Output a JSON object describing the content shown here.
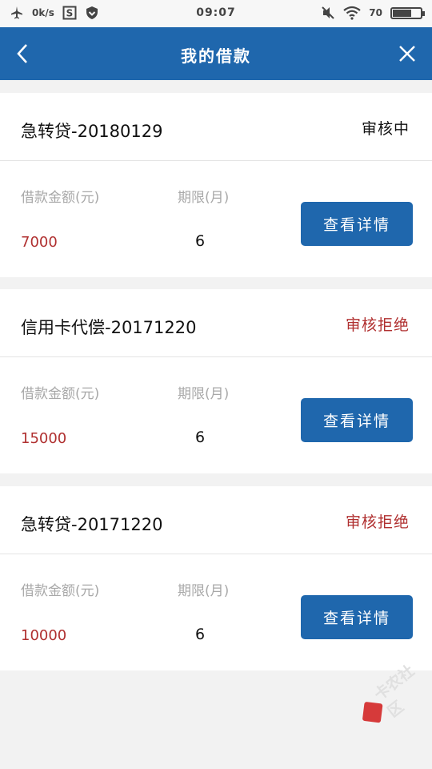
{
  "status_bar": {
    "speed": "0k/s",
    "time": "09:07",
    "battery": "70",
    "battery_level": 0.7
  },
  "header": {
    "title": "我的借款"
  },
  "loans": [
    {
      "name": "急转贷-20180129",
      "status": "审核中",
      "status_color": "#111111",
      "amount_label": "借款金额(元)",
      "term_label": "期限(月)",
      "amount": "7000",
      "term": "6",
      "button_label": "查看详情"
    },
    {
      "name": "信用卡代偿-20171220",
      "status": "审核拒绝",
      "status_color": "#b03030",
      "amount_label": "借款金额(元)",
      "term_label": "期限(月)",
      "amount": "15000",
      "term": "6",
      "button_label": "查看详情"
    },
    {
      "name": "急转贷-20171220",
      "status": "审核拒绝",
      "status_color": "#b03030",
      "amount_label": "借款金额(元)",
      "term_label": "期限(月)",
      "amount": "10000",
      "term": "6",
      "button_label": "查看详情"
    }
  ],
  "watermark": {
    "text": "卡农社区"
  },
  "colors": {
    "brand_blue": "#1f67ad",
    "reject_red": "#b03030"
  }
}
